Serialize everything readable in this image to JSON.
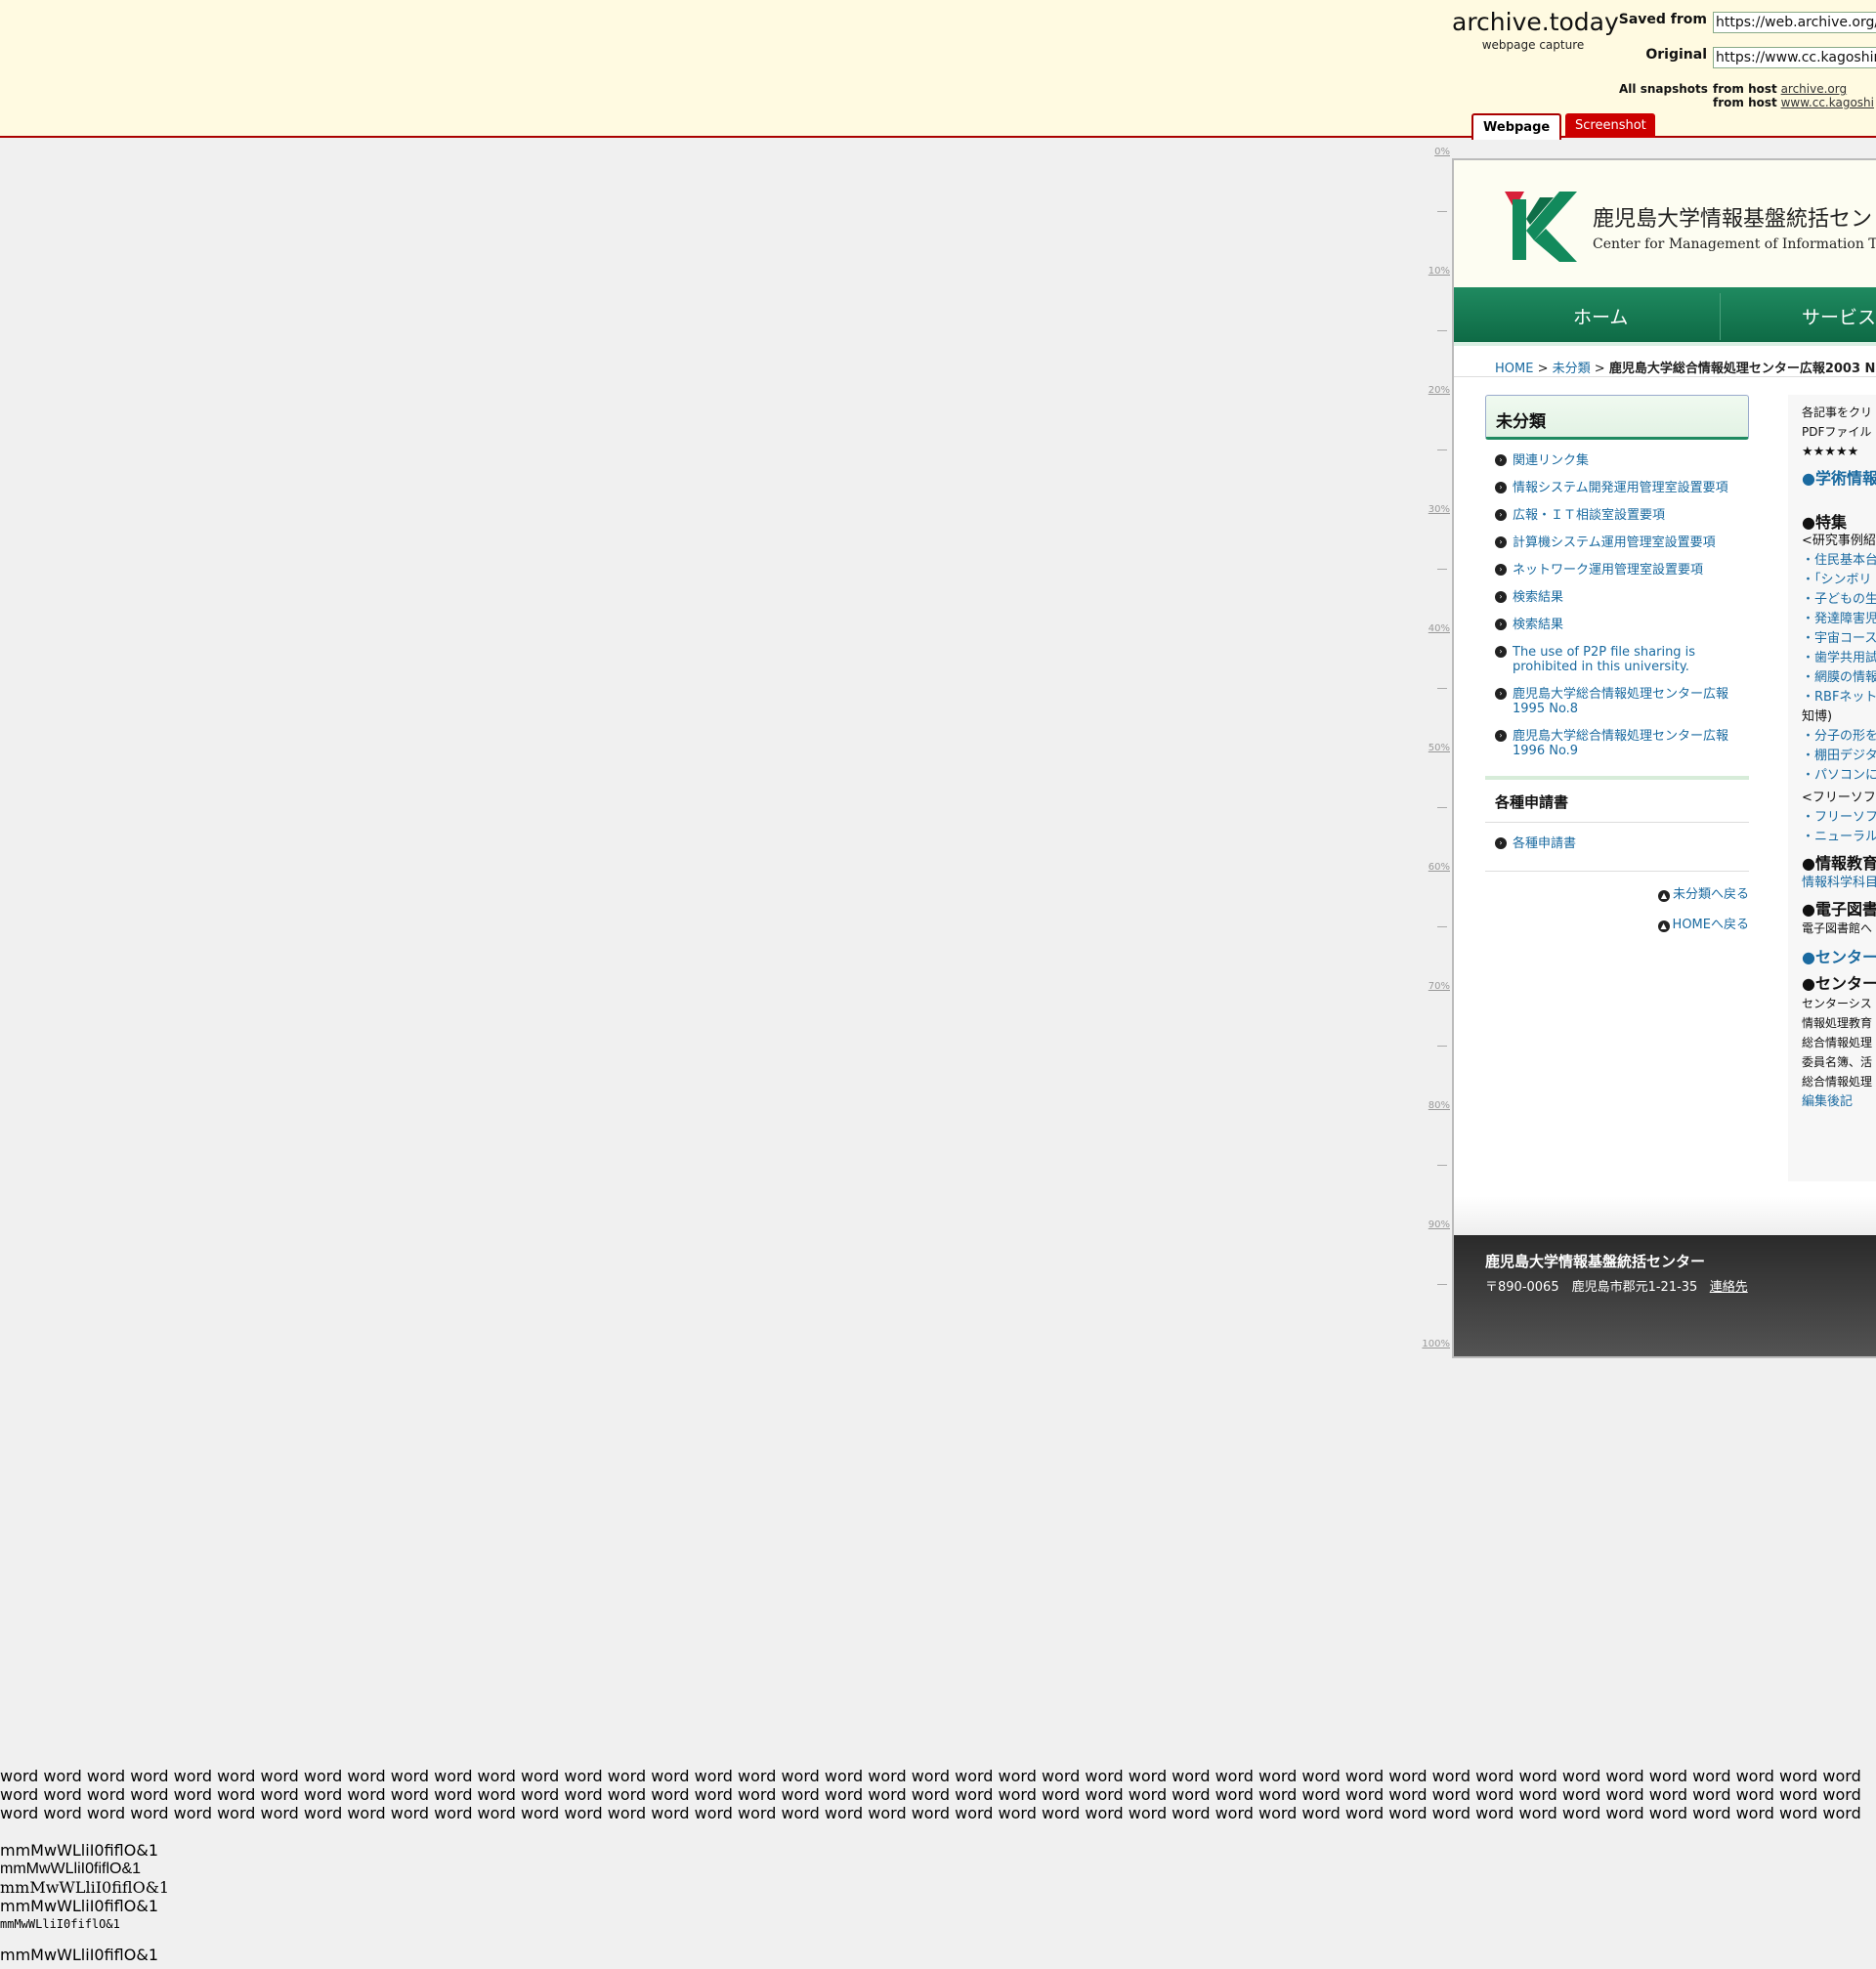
{
  "archive": {
    "title": "archive.today",
    "subtitle": "webpage capture",
    "saved_from_label": "Saved from",
    "saved_from_url": "https://web.archive.org/w",
    "original_label": "Original",
    "original_url": "https://www.cc.kagoshim",
    "all_snapshots_label": "All snapshots",
    "from_host_label": "from host",
    "host1": "archive.org",
    "host2": "www.cc.kagoshi",
    "tab_webpage": "Webpage",
    "tab_screenshot": "Screenshot",
    "scale": [
      "0%",
      "10%",
      "20%",
      "30%",
      "40%",
      "50%",
      "60%",
      "70%",
      "80%",
      "90%",
      "100%"
    ]
  },
  "site": {
    "title": "鹿児島大学情報基盤統括セン",
    "subtitle": "Center for Management of Information Techn",
    "nav": [
      "ホーム",
      "サービス"
    ],
    "crumb_home": "HOME",
    "crumb_cat": "未分類",
    "crumb_sep": ">",
    "crumb_current": "鹿児島大学総合情報処理センター広報2003 N",
    "side_heading": "未分類",
    "side_items": [
      "関連リンク集",
      "情報システム開発運用管理室設置要項",
      "広報・ＩＴ相談室設置要項",
      "計算機システム運用管理室設置要項",
      "ネットワーク運用管理室設置要項",
      "検索結果",
      "検索結果",
      "The use of P2P file sharing is prohibited in this university.",
      "鹿児島大学総合情報処理センター広報 1995 No.8",
      "鹿児島大学総合情報処理センター広報 1996 No.9"
    ],
    "side2_heading": "各種申請書",
    "side2_items": [
      "各種申請書"
    ],
    "back_cat": "未分類へ戻る",
    "back_home": "HOMEへ戻る",
    "main_lines": [
      {
        "t": "各記事をクリ",
        "c": "sm"
      },
      {
        "t": "PDFファイル",
        "c": "sm"
      },
      {
        "t": "★★★★★",
        "c": ""
      },
      {
        "t": "●学術情報",
        "c": "hl"
      },
      {
        "t": "●特集",
        "c": "h"
      },
      {
        "t": "<研究事例紹",
        "c": ""
      },
      {
        "t": "・住民基本台",
        "c": "l"
      },
      {
        "t": "・「シンボリ",
        "c": "l"
      },
      {
        "t": "・子どもの生",
        "c": "l"
      },
      {
        "t": "・発達障害児",
        "c": "l"
      },
      {
        "t": "・宇宙コース",
        "c": "l"
      },
      {
        "t": "・歯学共用試",
        "c": "l"
      },
      {
        "t": "・網膜の情報",
        "c": "l"
      },
      {
        "t": "・RBFネット",
        "c": "l"
      },
      {
        "t": "知博)",
        "c": ""
      },
      {
        "t": "・分子の形を",
        "c": "l"
      },
      {
        "t": "・棚田デジタ",
        "c": "l"
      },
      {
        "t": "・パソコンに",
        "c": "l"
      },
      {
        "t": "<フリーソフ",
        "c": ""
      },
      {
        "t": "・フリーソフ",
        "c": "l"
      },
      {
        "t": "・ニューラル",
        "c": "l"
      },
      {
        "t": "●情報教育",
        "c": "h"
      },
      {
        "t": "情報科学科目",
        "c": "l"
      },
      {
        "t": "●電子図書",
        "c": "h"
      },
      {
        "t": "電子図書館へ",
        "c": "sm"
      },
      {
        "t": "●センター",
        "c": "hl"
      },
      {
        "t": "●センター",
        "c": "h"
      },
      {
        "t": "センターシス",
        "c": "sm"
      },
      {
        "t": "情報処理教育",
        "c": "sm"
      },
      {
        "t": "総合情報処理",
        "c": "sm"
      },
      {
        "t": "委員名簿、活",
        "c": "sm"
      },
      {
        "t": "総合情報処理",
        "c": "sm"
      },
      {
        "t": "編集後記",
        "c": "l"
      }
    ],
    "footer_title": "鹿児島大学情報基盤統括センター",
    "footer_addr": "〒890-0065　鹿児島市郡元1-21-35",
    "footer_contact": "連絡先"
  },
  "testlines": {
    "words": "word word word word word word word word word word word word word word word word word word word word word word word word word word word word word word word word word word word word word word word word word word word word word word word word word word word word word word word word word word word word word word word word word word word word word word word word word word word word word word word word word word word word word word word word word word word word word word word word word word word word word word word word word word word word word word word word word word word word word word word word word word word word word word word word word",
    "glyphs": "mmMwWLliI0fiflO&1"
  }
}
